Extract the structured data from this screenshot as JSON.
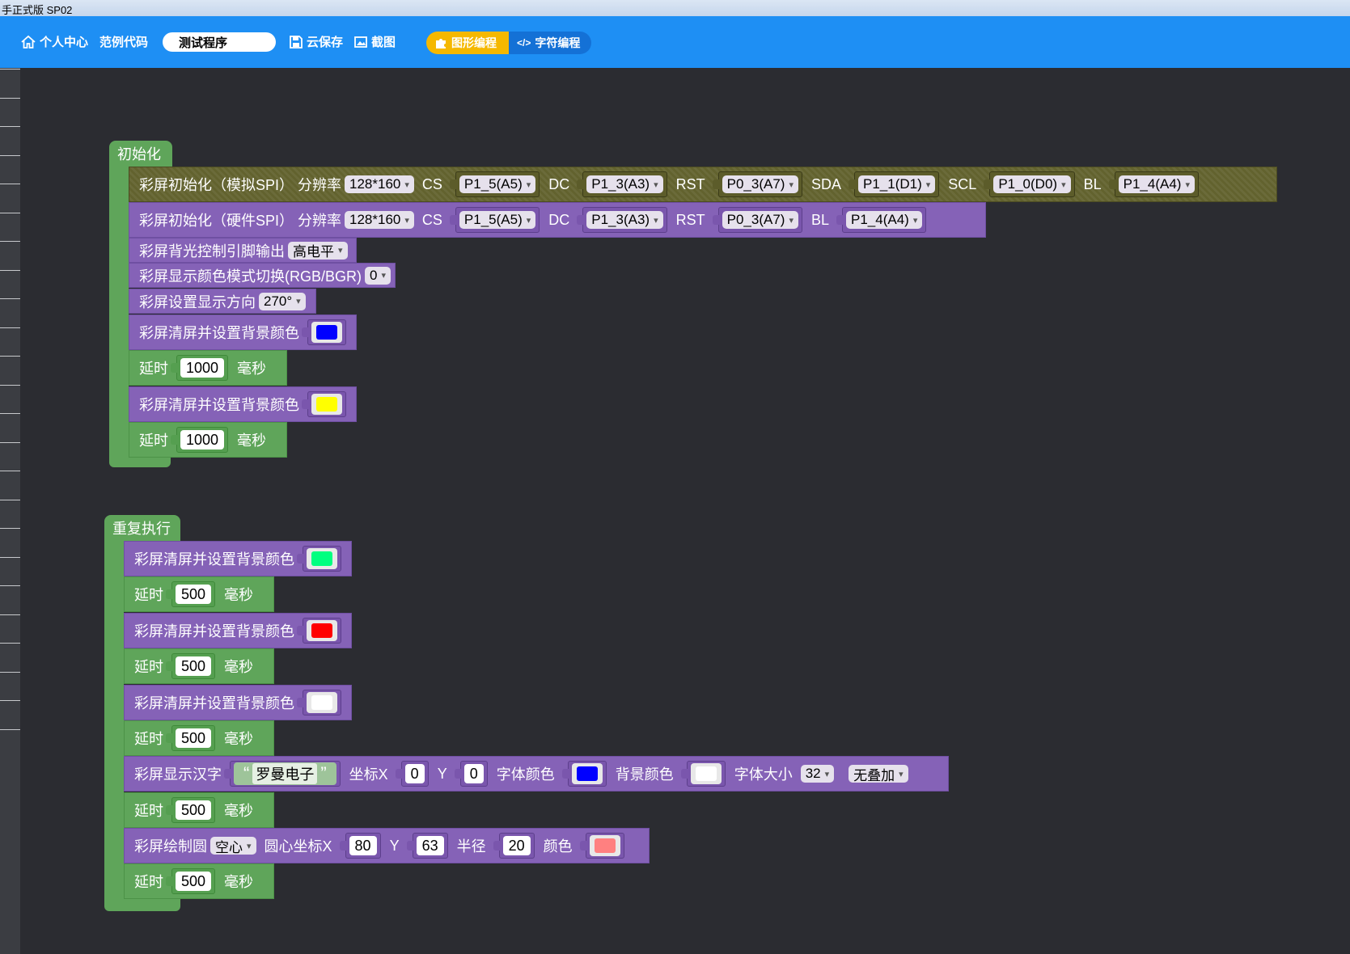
{
  "window": {
    "title": "手正式版 SP02"
  },
  "topbar": {
    "home_label": "个人中心",
    "examples_label": "范例代码",
    "program_name": "测试程序",
    "cloud_save_label": "云保存",
    "screenshot_label": "截图",
    "graphic_mode_label": "图形编程",
    "text_mode_label": "字符编程"
  },
  "colors": {
    "accent": "#1e8ff4",
    "workspace": "#2b2c31",
    "purple_block": "#8562b7",
    "green_block": "#5fa55a",
    "active_toggle": "#f5b800"
  },
  "init_hat": {
    "label": "初始化"
  },
  "init_blocks": {
    "b1": {
      "text": "彩屏初始化（模拟SPI）  分辨率",
      "res": "128*160",
      "cs_lbl": "CS",
      "cs": "P1_5(A5)",
      "dc_lbl": "DC",
      "dc": "P1_3(A3)",
      "rst_lbl": "RST",
      "rst": "P0_3(A7)",
      "sda_lbl": "SDA",
      "sda": "P1_1(D1)",
      "scl_lbl": "SCL",
      "scl": "P1_0(D0)",
      "bl_lbl": "BL",
      "bl": "P1_4(A4)"
    },
    "b2": {
      "text": "彩屏初始化（硬件SPI）  分辨率",
      "res": "128*160",
      "cs_lbl": "CS",
      "cs": "P1_5(A5)",
      "dc_lbl": "DC",
      "dc": "P1_3(A3)",
      "rst_lbl": "RST",
      "rst": "P0_3(A7)",
      "bl_lbl": "BL",
      "bl": "P1_4(A4)"
    },
    "b3": {
      "text": "彩屏背光控制引脚输出",
      "value": "高电平"
    },
    "b4": {
      "text": "彩屏显示颜色模式切换(RGB/BGR)",
      "value": "0"
    },
    "b5": {
      "text": "彩屏设置显示方向",
      "value": "270°"
    },
    "b6": {
      "text": "彩屏清屏并设置背景颜色",
      "color": "#0000ff"
    },
    "b7": {
      "text": "延时",
      "value": "1000",
      "unit": "毫秒"
    },
    "b8": {
      "text": "彩屏清屏并设置背景颜色",
      "color": "#ffff00"
    },
    "b9": {
      "text": "延时",
      "value": "1000",
      "unit": "毫秒"
    }
  },
  "loop_hat": {
    "label": "重复执行"
  },
  "loop_blocks": {
    "c1": {
      "text": "彩屏清屏并设置背景颜色",
      "color": "#00ff80"
    },
    "c2": {
      "text": "延时",
      "value": "500",
      "unit": "毫秒"
    },
    "c3": {
      "text": "彩屏清屏并设置背景颜色",
      "color": "#ff0000"
    },
    "c4": {
      "text": "延时",
      "value": "500",
      "unit": "毫秒"
    },
    "c5": {
      "text": "彩屏清屏并设置背景颜色",
      "color": "#ffffff"
    },
    "c6": {
      "text": "延时",
      "value": "500",
      "unit": "毫秒"
    },
    "c7": {
      "text": "彩屏显示汉字",
      "string": "罗曼电子",
      "x_lbl": "坐标X",
      "x": "0",
      "y_lbl": "Y",
      "y": "0",
      "fc_lbl": "字体颜色",
      "font_color": "#0000ff",
      "bc_lbl": "背景颜色",
      "bg_color": "#ffffff",
      "size_lbl": "字体大小",
      "size": "32",
      "overlay": "无叠加"
    },
    "c8": {
      "text": "延时",
      "value": "500",
      "unit": "毫秒"
    },
    "c9": {
      "text": "彩屏绘制圆",
      "mode": "空心",
      "cx_lbl": "圆心坐标X",
      "cx": "80",
      "cy_lbl": "Y",
      "cy": "63",
      "r_lbl": "半径",
      "r": "20",
      "color_lbl": "颜色",
      "color": "#ff8080"
    },
    "c10": {
      "text": "延时",
      "value": "500",
      "unit": "毫秒"
    }
  }
}
